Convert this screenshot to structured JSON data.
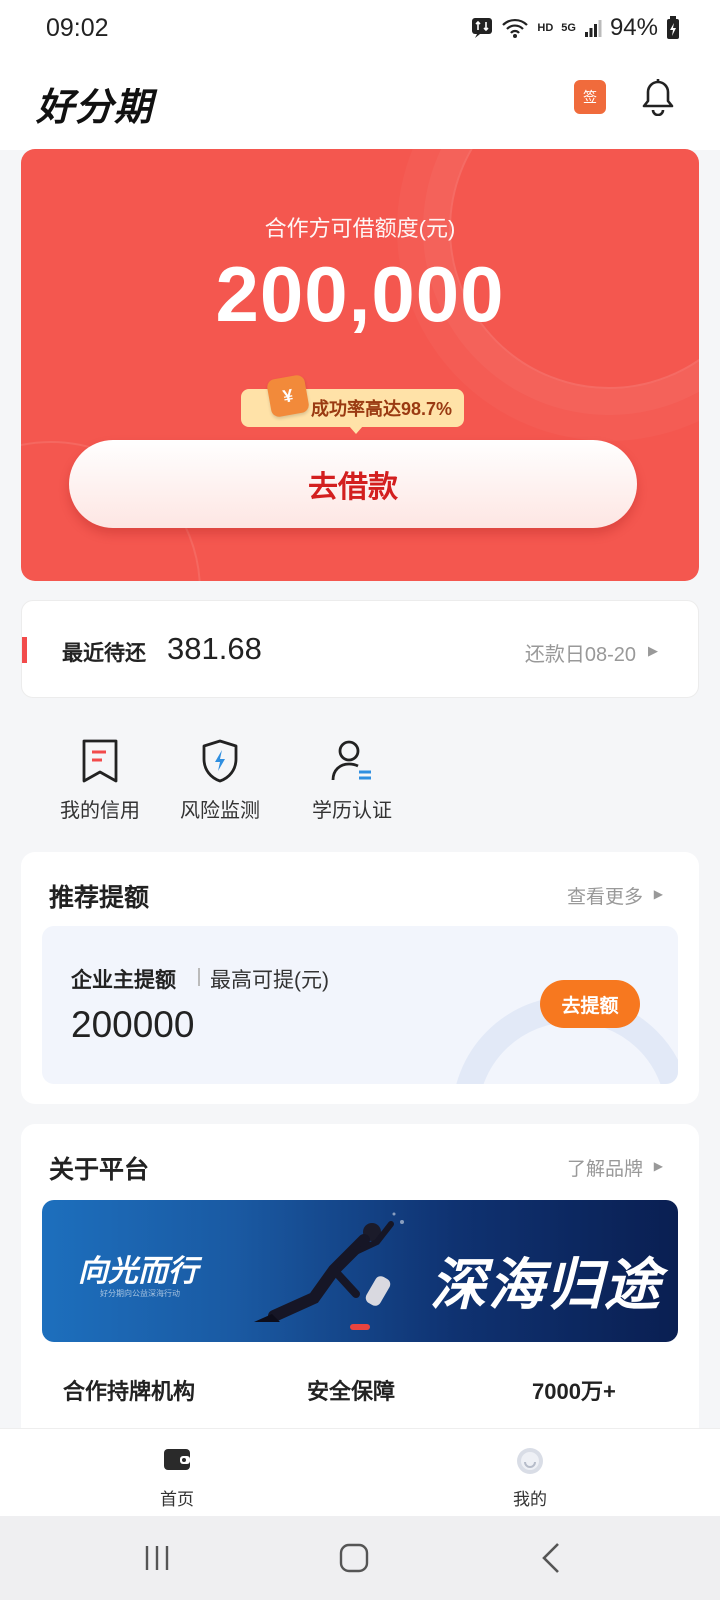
{
  "status": {
    "time": "09:02",
    "network_hd": "HD",
    "network_5g": "5G",
    "battery": "94%"
  },
  "app": {
    "logo": "好分期"
  },
  "header": {
    "checkin_icon_text": "签"
  },
  "hero": {
    "label": "合作方可借额度(元)",
    "amount": "200,000",
    "success_rate": "成功率高达98.7%",
    "coupon_symbol": "¥",
    "borrow_label": "去借款"
  },
  "repay": {
    "label": "最近待还",
    "amount": "381.68",
    "date": "还款日08-20"
  },
  "shortcuts": [
    {
      "label": "我的信用",
      "icon": "credit-report-icon"
    },
    {
      "label": "风险监测",
      "icon": "shield-icon"
    },
    {
      "label": "学历认证",
      "icon": "user-education-icon"
    }
  ],
  "recommend": {
    "title": "推荐提额",
    "more": "查看更多",
    "quota_title": "企业主提额",
    "quota_sub": "最高可提(元)",
    "quota_amount": "200000",
    "quota_button": "去提额"
  },
  "about": {
    "title": "关于平台",
    "more": "了解品牌",
    "banner_left": "向光而行",
    "banner_left_sub": "好分期向公益深海行动",
    "banner_right": "深海归途",
    "stats": [
      "合作持牌机构",
      "安全保障",
      "7000万+"
    ]
  },
  "tabs": [
    {
      "label": "首页",
      "icon": "wallet-icon"
    },
    {
      "label": "我的",
      "icon": "profile-icon"
    }
  ],
  "colors": {
    "brand_red": "#f4574f",
    "accent_orange": "#f7781f",
    "tag_yellow": "#ffe2a8"
  }
}
